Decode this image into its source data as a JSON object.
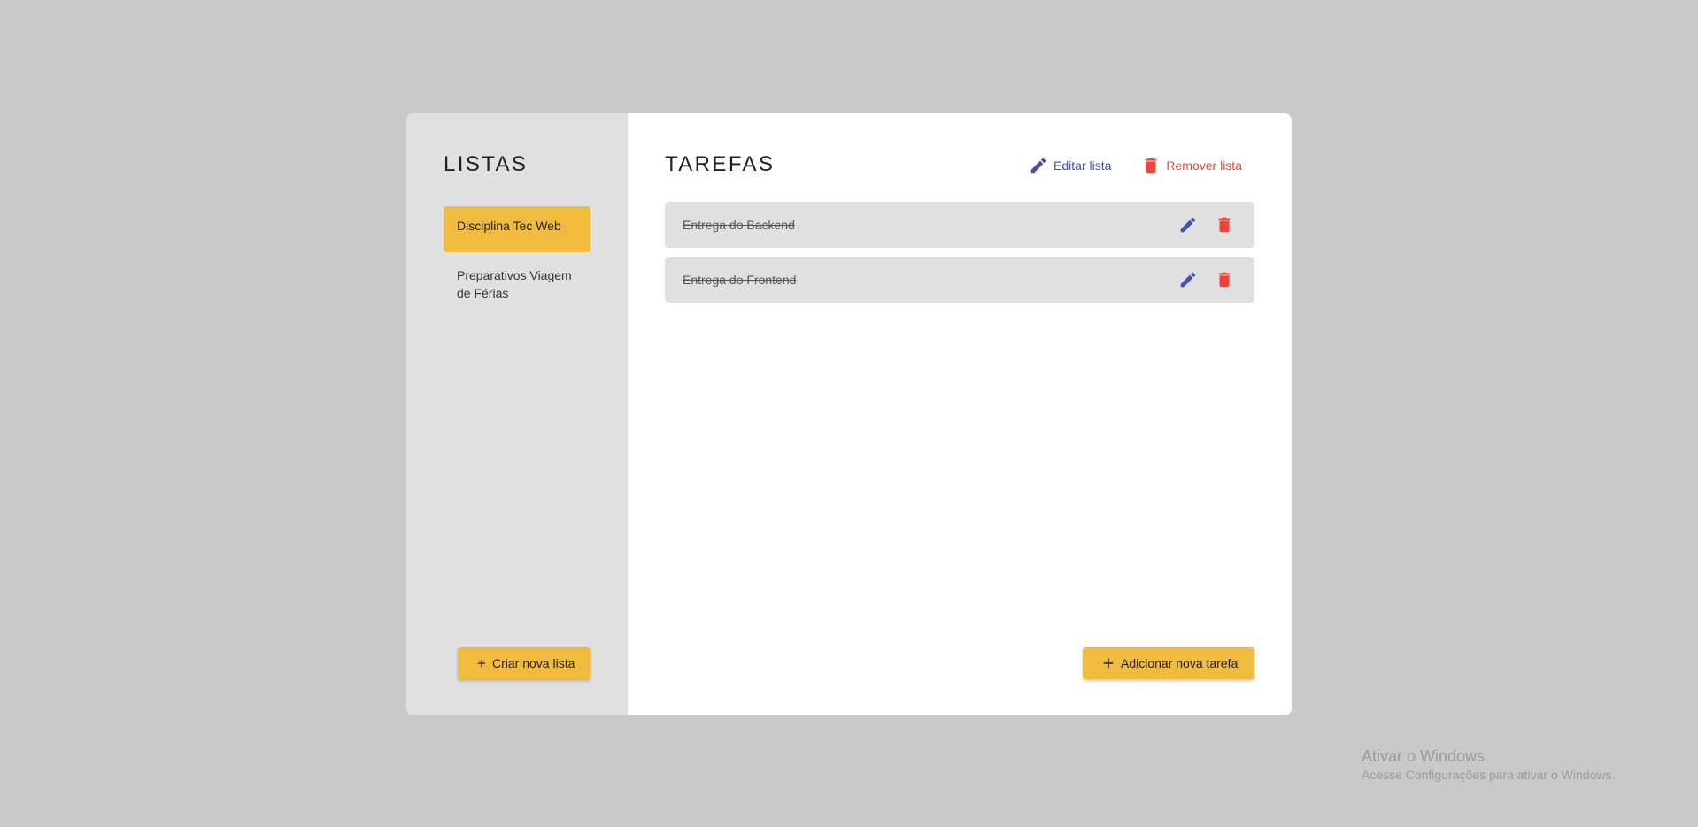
{
  "sidebar": {
    "title": "LISTAS",
    "items": [
      {
        "label": "Disciplina Tec Web",
        "active": true
      },
      {
        "label": "Preparativos Viagem de Férias",
        "active": false
      }
    ],
    "create_button": {
      "label": "Criar nova lista",
      "icon": "plus-icon"
    }
  },
  "main": {
    "title": "TAREFAS",
    "actions": {
      "edit_label": "Editar lista",
      "edit_icon": "pencil-icon",
      "remove_label": "Remover lista",
      "remove_icon": "trash-icon"
    },
    "tasks": [
      {
        "label": "Entrega do Backend",
        "done": true
      },
      {
        "label": "Entrega do Frontend",
        "done": true
      }
    ],
    "add_button": {
      "label": "Adicionar nova tarefa",
      "icon": "plus-icon"
    }
  },
  "watermark": {
    "title": "Ativar o Windows",
    "subtitle": "Acesse Configurações para ativar o Windows."
  },
  "colors": {
    "background": "#c9c9c9",
    "sidebar": "#e0e0e0",
    "accent_yellow": "#f0bb3f",
    "edit_blue": "#3f51b5",
    "remove_red": "#f44336"
  }
}
